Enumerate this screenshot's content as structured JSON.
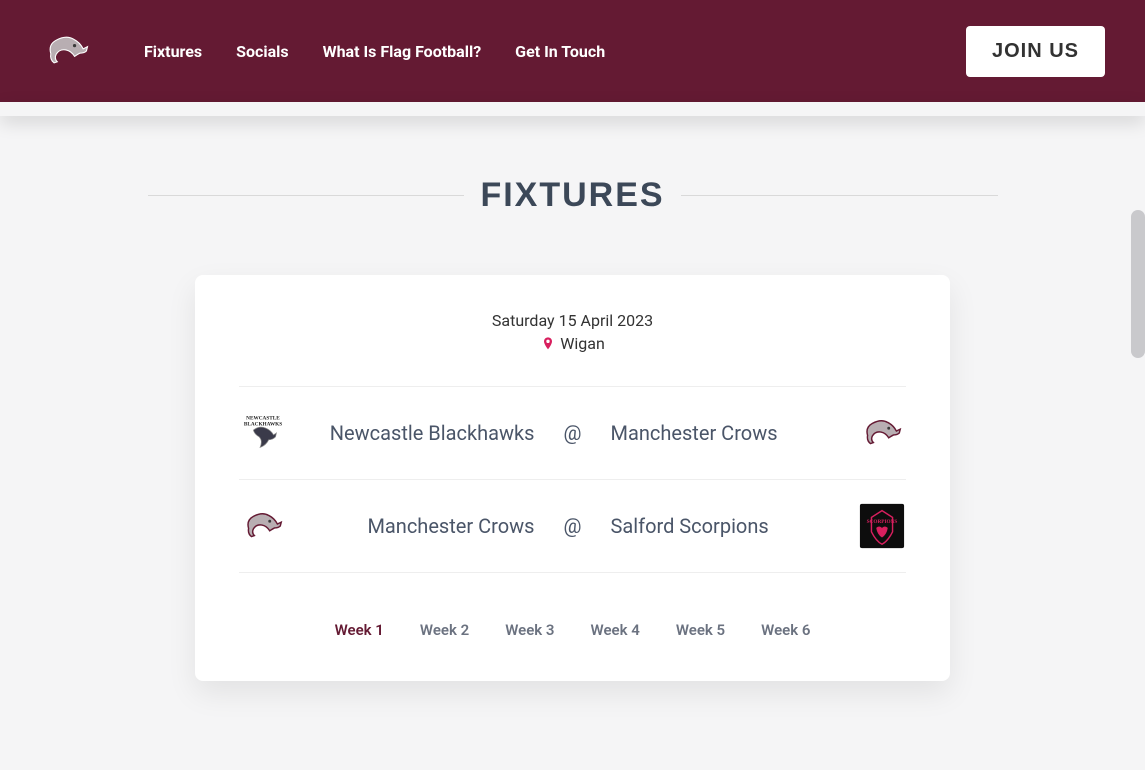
{
  "nav": {
    "links": [
      "Fixtures",
      "Socials",
      "What Is Flag Football?",
      "Get In Touch"
    ],
    "cta": "JOIN US"
  },
  "section_title": "FIXTURES",
  "fixture_card": {
    "date": "Saturday 15 April 2023",
    "location": "Wigan",
    "matches": [
      {
        "home": "Newcastle Blackhawks",
        "away": "Manchester Crows",
        "at": "@",
        "home_logo": "blackhawks",
        "away_logo": "crows"
      },
      {
        "home": "Manchester Crows",
        "away": "Salford Scorpions",
        "at": "@",
        "home_logo": "crows",
        "away_logo": "scorpions"
      }
    ],
    "weeks": [
      "Week 1",
      "Week 2",
      "Week 3",
      "Week 4",
      "Week 5",
      "Week 6"
    ],
    "active_week": "Week 1"
  },
  "colors": {
    "brand": "#641a33",
    "accent_pink": "#d81f5e"
  }
}
